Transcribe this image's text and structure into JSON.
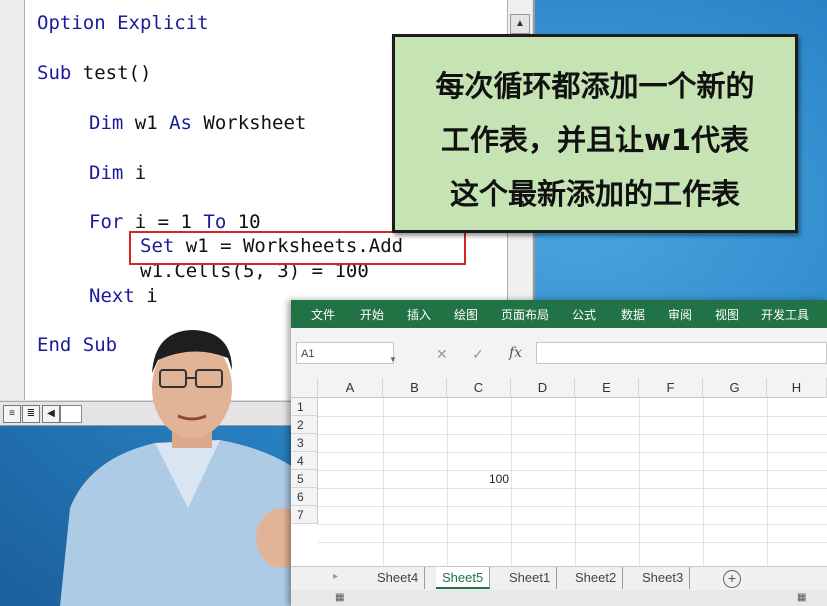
{
  "vba": {
    "lines": [
      {
        "kw": "Option Explicit",
        "rest": ""
      },
      {
        "kw": "Sub",
        "rest": " test()"
      },
      {
        "kw": "Dim",
        "rest": " w1 ",
        "kw2": "As",
        "rest2": " Worksheet"
      },
      {
        "kw": "Dim",
        "rest": " i"
      },
      {
        "kw": "For",
        "rest": " i = 1 ",
        "kw2": "To",
        "rest2": " 10"
      },
      {
        "kw": "Set",
        "rest": " w1 = Worksheets.Add"
      },
      {
        "kw": "",
        "rest": "w1.Cells(5, 3) = 100"
      },
      {
        "kw": "Next",
        "rest": " i"
      },
      {
        "kw": "End Sub",
        "rest": ""
      }
    ],
    "scroll_up_glyph": "▲",
    "view_btn1": "≡",
    "view_btn2": "≣",
    "hscroll_left": "◀"
  },
  "callout": {
    "line1": "每次循环都添加一个新的",
    "line2": "工作表，并且让w1代表",
    "line3": "这个最新添加的工作表"
  },
  "excel": {
    "ribbon_tabs": [
      "文件",
      "开始",
      "插入",
      "绘图",
      "页面布局",
      "公式",
      "数据",
      "审阅",
      "视图",
      "开发工具"
    ],
    "name_box": "A1",
    "name_box_arrow": "▼",
    "cancel_glyph": "✕",
    "confirm_glyph": "✓",
    "fx_label": "fx",
    "columns": [
      "A",
      "B",
      "C",
      "D",
      "E",
      "F",
      "G",
      "H"
    ],
    "rows": [
      "1",
      "2",
      "3",
      "4",
      "5",
      "6",
      "7"
    ],
    "cell_c5": "100",
    "sheet_tabs": [
      "Sheet4",
      "Sheet5",
      "Sheet1",
      "Sheet2",
      "Sheet3"
    ],
    "active_sheet": "Sheet5",
    "add_sheet_glyph": "+",
    "tab_nav_glyph": "▸",
    "status_icon": "▦",
    "view_icon": "▦",
    "accent": "#217346"
  }
}
